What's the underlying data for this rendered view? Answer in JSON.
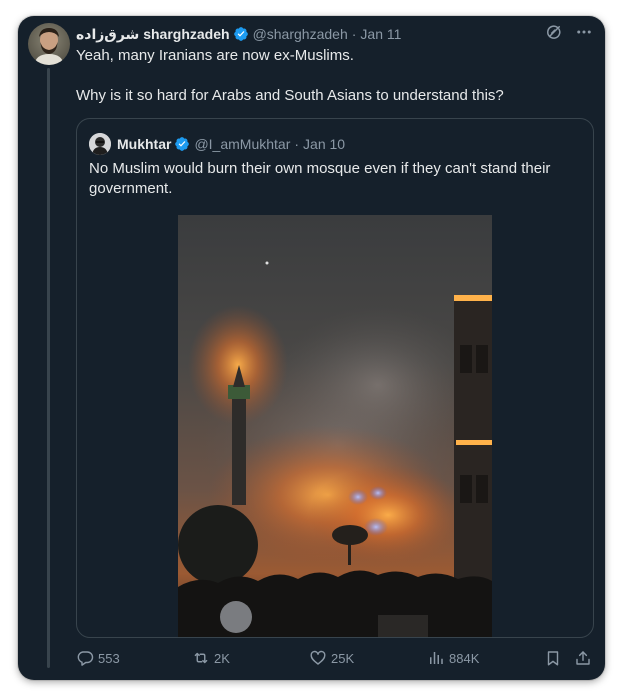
{
  "tweet": {
    "author": {
      "display_name": "شرق‌زاده sharghzadeh",
      "handle": "@sharghzadeh",
      "verified": true
    },
    "separator": "·",
    "date": "Jan 11",
    "text_line1": "Yeah, many Iranians are now ex-Muslims.",
    "text_line2": "Why is it so hard for Arabs and South Asians to understand this?",
    "top_icons": [
      "grok-icon",
      "more-icon"
    ]
  },
  "quote": {
    "author": {
      "display_name": "Mukhtar",
      "handle": "@I_amMukhtar",
      "verified": true
    },
    "separator": "·",
    "date": "Jan 10",
    "text": "No Muslim would burn their own mosque even if they can't stand their government.",
    "media": "video-still"
  },
  "actions": {
    "replies": "553",
    "retweets": "2K",
    "likes": "25K",
    "views": "884K"
  },
  "colors": {
    "background": "#15202b",
    "text": "#e7e9ea",
    "secondary": "#8b98a5",
    "border": "#38444d",
    "verified": "#1d9bf0"
  }
}
